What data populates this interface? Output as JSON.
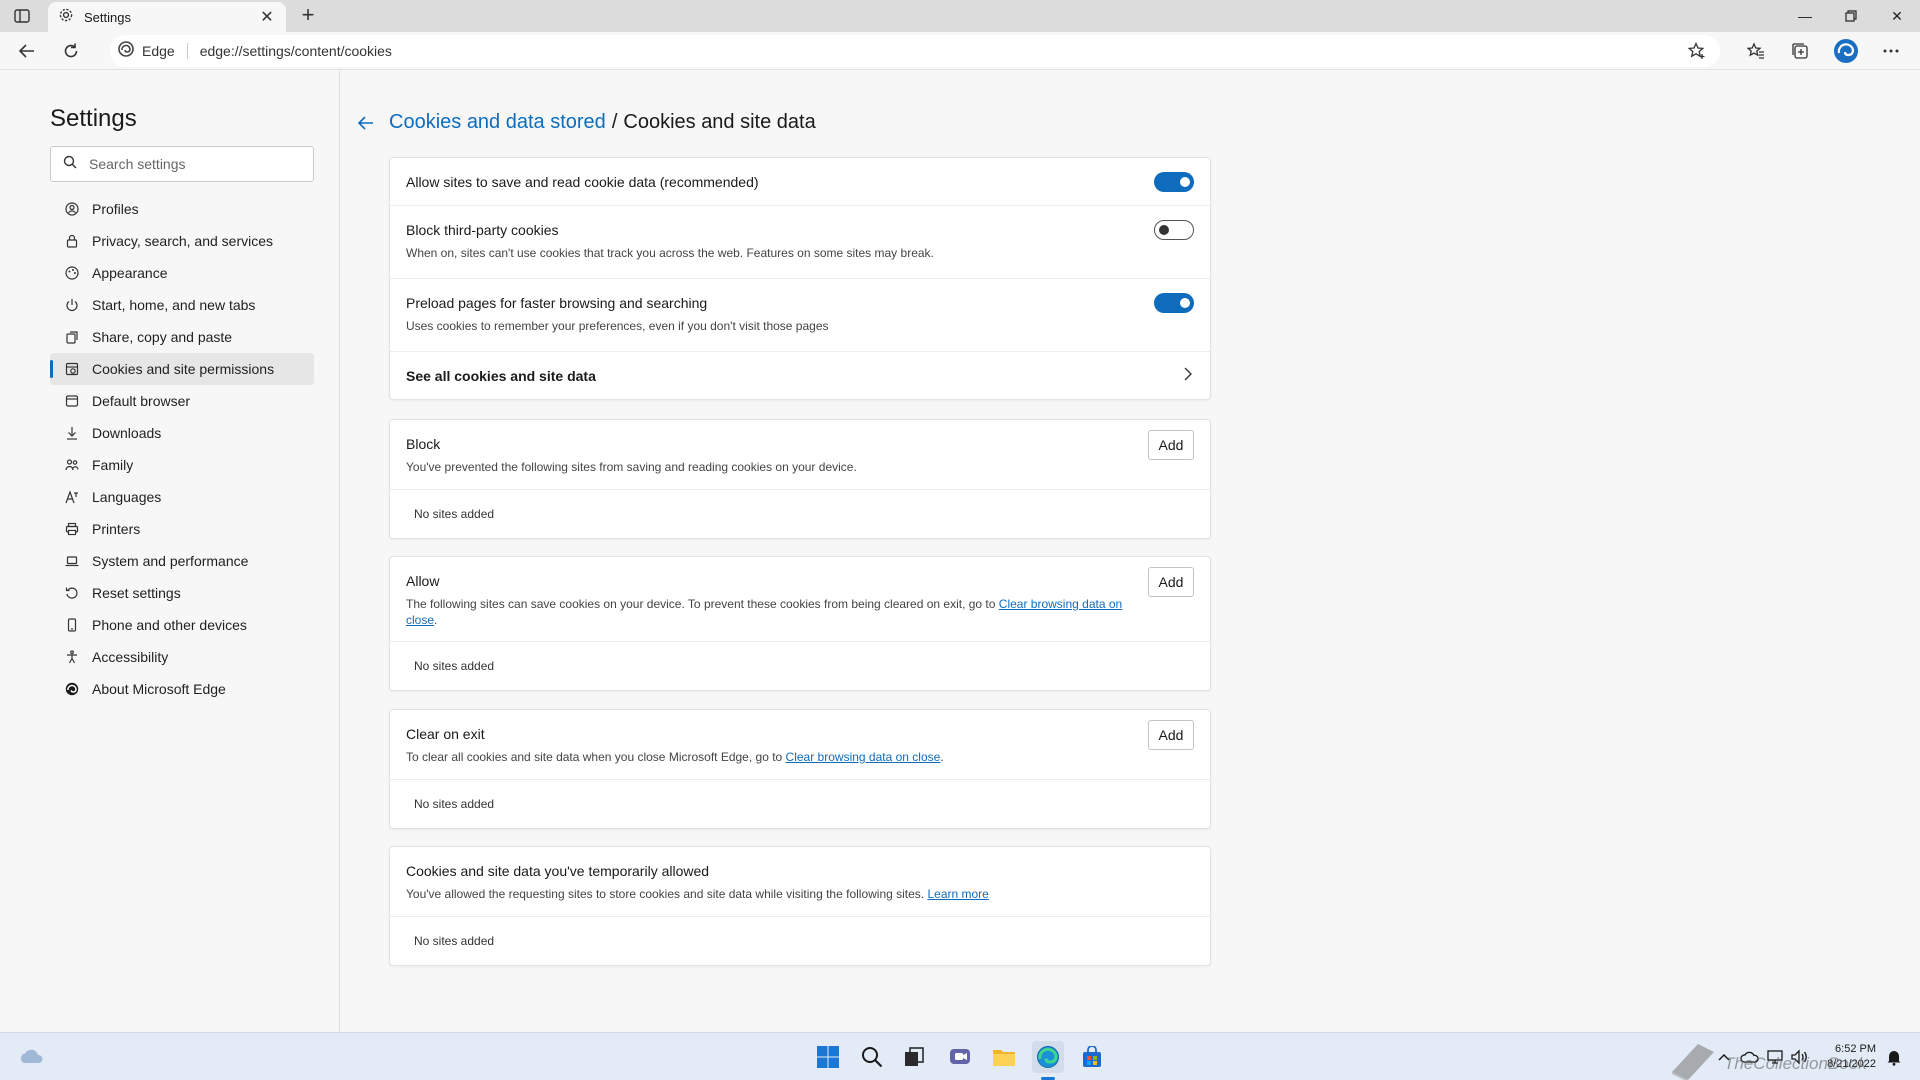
{
  "browser": {
    "tab_title": "Settings",
    "address_brand": "Edge",
    "url": "edge://settings/content/cookies"
  },
  "nav": {
    "title": "Settings",
    "search_placeholder": "Search settings",
    "items": [
      {
        "label": "Profiles",
        "icon": "profile-icon"
      },
      {
        "label": "Privacy, search, and services",
        "icon": "lock-icon"
      },
      {
        "label": "Appearance",
        "icon": "appearance-icon"
      },
      {
        "label": "Start, home, and new tabs",
        "icon": "power-icon"
      },
      {
        "label": "Share, copy and paste",
        "icon": "share-icon"
      },
      {
        "label": "Cookies and site permissions",
        "icon": "cookies-icon",
        "active": true
      },
      {
        "label": "Default browser",
        "icon": "browser-icon"
      },
      {
        "label": "Downloads",
        "icon": "download-icon"
      },
      {
        "label": "Family",
        "icon": "family-icon"
      },
      {
        "label": "Languages",
        "icon": "language-icon"
      },
      {
        "label": "Printers",
        "icon": "printer-icon"
      },
      {
        "label": "System and performance",
        "icon": "laptop-icon"
      },
      {
        "label": "Reset settings",
        "icon": "reset-icon"
      },
      {
        "label": "Phone and other devices",
        "icon": "phone-icon"
      },
      {
        "label": "Accessibility",
        "icon": "accessibility-icon"
      },
      {
        "label": "About Microsoft Edge",
        "icon": "edge-icon"
      }
    ]
  },
  "breadcrumb": {
    "parent": "Cookies and data stored",
    "separator": "/",
    "current": "Cookies and site data"
  },
  "settings": {
    "allow_cookies": {
      "label": "Allow sites to save and read cookie data (recommended)",
      "enabled": true
    },
    "block_third_party": {
      "label": "Block third-party cookies",
      "description": "When on, sites can't use cookies that track you across the web. Features on some sites may break.",
      "enabled": false
    },
    "preload": {
      "label": "Preload pages for faster browsing and searching",
      "description": "Uses cookies to remember your preferences, even if you don't visit those pages",
      "enabled": true
    },
    "see_all": {
      "label": "See all cookies and site data"
    }
  },
  "sections": {
    "block": {
      "title": "Block",
      "description": "You've prevented the following sites from saving and reading cookies on your device.",
      "add_label": "Add",
      "empty": "No sites added"
    },
    "allow": {
      "title": "Allow",
      "description_pre": "The following sites can save cookies on your device. To prevent these cookies from being cleared on exit, go to ",
      "link": "Clear browsing data on close",
      "description_post": ".",
      "add_label": "Add",
      "empty": "No sites added"
    },
    "clear_on_exit": {
      "title": "Clear on exit",
      "description_pre": "To clear all cookies and site data when you close Microsoft Edge, go to ",
      "link": "Clear browsing data on close",
      "description_post": ".",
      "add_label": "Add",
      "empty": "No sites added"
    },
    "temporarily_allowed": {
      "title": "Cookies and site data you've temporarily allowed",
      "description_pre": "You've allowed the requesting sites to store cookies and site data while visiting the following sites. ",
      "link": "Learn more",
      "empty": "No sites added"
    }
  },
  "taskbar": {
    "time": "6:52 PM",
    "date": "8/21/2022",
    "watermark": "TheCollectionBook"
  },
  "colors": {
    "accent": "#0f6cbd",
    "page_bg": "#f7f7f7",
    "card_bg": "#ffffff",
    "taskbar_bg": "#e3ecf6"
  }
}
